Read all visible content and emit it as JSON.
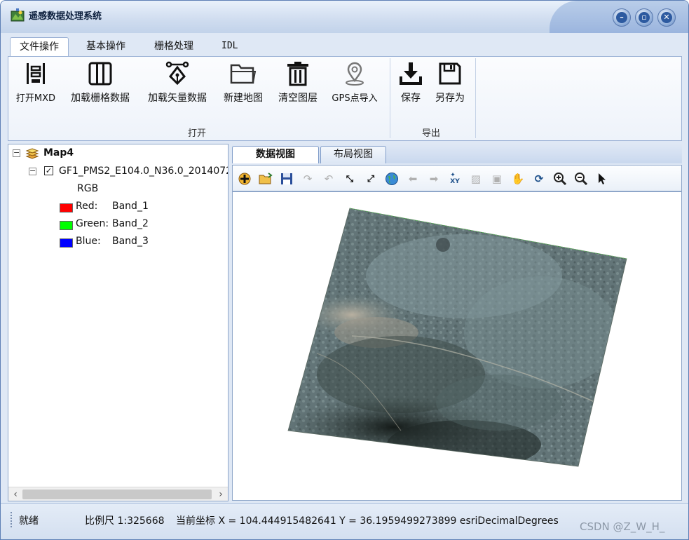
{
  "window": {
    "title": "遥感数据处理系统",
    "minimize_icon": "minimize-icon",
    "maximize_icon": "maximize-icon",
    "close_icon": "close-icon"
  },
  "ribbon": {
    "tabs": [
      {
        "label": "文件操作",
        "active": true
      },
      {
        "label": "基本操作",
        "active": false
      },
      {
        "label": "栅格处理",
        "active": false
      },
      {
        "label": "IDL",
        "active": false
      }
    ],
    "groups": [
      {
        "label": "打开",
        "buttons": [
          {
            "label": "打开MXD",
            "icon": "open-mxd-icon"
          },
          {
            "label": "加载栅格数据",
            "icon": "raster-grid-icon"
          },
          {
            "label": "加载矢量数据",
            "icon": "vector-pen-icon"
          },
          {
            "label": "新建地图",
            "icon": "folder-icon"
          },
          {
            "label": "清空图层",
            "icon": "trash-icon"
          },
          {
            "label": "GPS点导入",
            "icon": "location-pin-icon"
          }
        ]
      },
      {
        "label": "导出",
        "buttons": [
          {
            "label": "保存",
            "icon": "download-icon"
          },
          {
            "label": "另存为",
            "icon": "save-disk-icon"
          }
        ]
      }
    ]
  },
  "toc": {
    "map_name": "Map4",
    "layer_name": "GF1_PMS2_E104.0_N36.0_2014072",
    "renderer": "RGB",
    "bands": [
      {
        "channel": "Red:",
        "band": "Band_1",
        "color": "#ff0000"
      },
      {
        "channel": "Green:",
        "band": "Band_2",
        "color": "#00ff00"
      },
      {
        "channel": "Blue:",
        "band": "Band_3",
        "color": "#0000ff"
      }
    ]
  },
  "map": {
    "tabs": [
      {
        "label": "数据视图",
        "active": true
      },
      {
        "label": "布局视图",
        "active": false
      }
    ],
    "tools": [
      "add-data-icon",
      "open-folder-icon",
      "save-icon",
      "redo-icon",
      "undo-icon",
      "fixed-zoom-in-icon",
      "fixed-zoom-out-icon",
      "full-extent-globe-icon",
      "back-arrow-icon",
      "forward-arrow-icon",
      "xy-coordinate-icon",
      "identify-icon",
      "select-feature-icon",
      "pan-hand-icon",
      "refresh-icon",
      "zoom-in-icon",
      "zoom-out-icon",
      "pointer-icon"
    ]
  },
  "status": {
    "ready": "就绪",
    "scale": "比例尺 1:325668",
    "coords": "当前坐标 X = 104.444915482641 Y = 36.1959499273899 esriDecimalDegrees",
    "watermark": "CSDN @Z_W_H_"
  }
}
